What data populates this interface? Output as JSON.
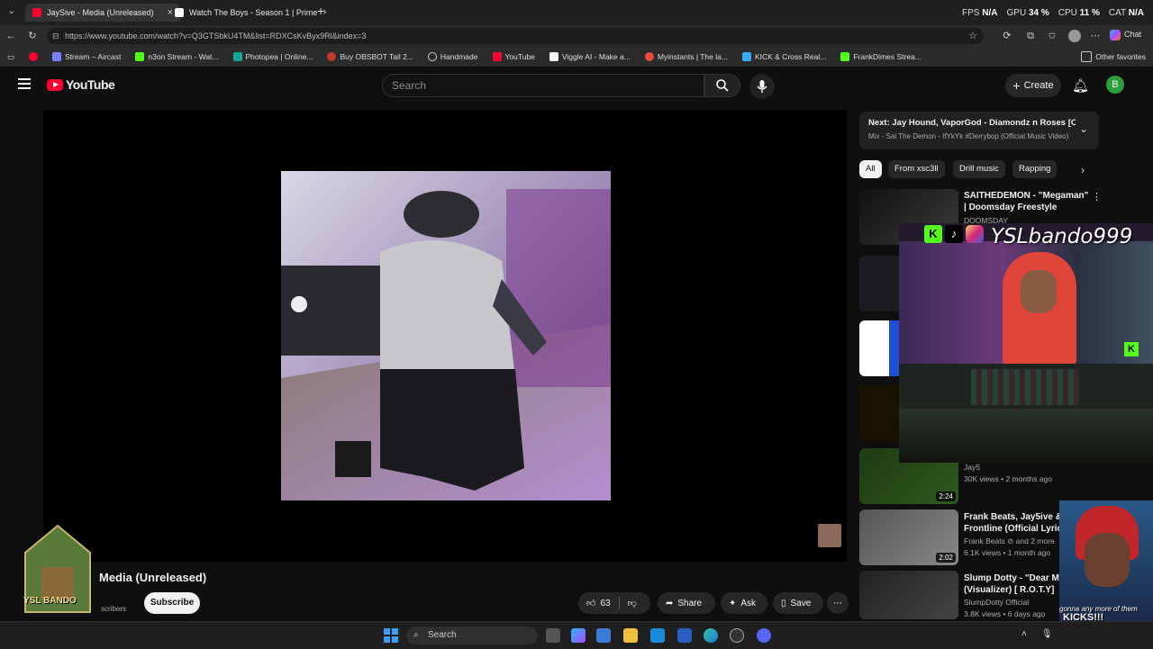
{
  "browser": {
    "tabs": [
      {
        "title": "JaySive - Media (Unreleased)",
        "active": true,
        "favicon_color": "#ff0033"
      },
      {
        "title": "Watch The Boys - Season 1 | Prime",
        "active": false,
        "favicon_color": "#ffffff"
      }
    ],
    "new_tab_symbol": "+",
    "close_symbol": "×",
    "stats": {
      "fps_label": "FPS",
      "fps_value": "N/A",
      "gpu_label": "GPU",
      "gpu_value": "34 %",
      "cpu_label": "CPU",
      "cpu_value": "11 %",
      "cat_label": "CAT",
      "cat_value": "N/A"
    },
    "url": "https://www.youtube.com/watch?v=Q3GTSbkU4TM&list=RDXCsKvByx9Rl&index=3",
    "chat_label": "Chat",
    "bookmarks": [
      {
        "label": "Stream – Aircast",
        "icon_color": "#7f7fff"
      },
      {
        "label": "n3on Stream - Wat...",
        "icon_color": "#53fc18"
      },
      {
        "label": "Photopea | Online...",
        "icon_color": "#18a497"
      },
      {
        "label": "Buy OBSBOT Tail 2...",
        "icon_color": "#c0392b"
      },
      {
        "label": "Handmade",
        "icon_color": "#cccccc"
      },
      {
        "label": "YouTube",
        "icon_color": "#ff0033"
      },
      {
        "label": "Viggle AI - Make a...",
        "icon_color": "#ffffff"
      },
      {
        "label": "Myinstants | The la...",
        "icon_color": "#e74c3c"
      },
      {
        "label": "KICK & Cross Real...",
        "icon_color": "#3fa9f5"
      },
      {
        "label": "FrankDimes Strea...",
        "icon_color": "#53fc18"
      }
    ],
    "other_favorites": "Other favorites"
  },
  "youtube": {
    "logo_text": "YouTube",
    "search_placeholder": "Search",
    "create_label": "Create",
    "avatar_letter": "B",
    "next": {
      "title": "Next: Jay Hound, VaporGod - Diamondz n Roses [O...",
      "subtitle": "Mix - Sai The Demon - IfYkYk #Derrybop (Official Music Video)"
    },
    "chips": [
      "All",
      "From xsc3ll",
      "Drill music",
      "Rapping"
    ],
    "recommendations": [
      {
        "title": "SAITHEDEMON - \"Megaman\" | Doomsday Freestyle",
        "meta1": "DOOMSDAY",
        "meta2": "",
        "duration": ""
      },
      {
        "title": "",
        "meta1": "Jay5",
        "meta2": "30K views • 2 months ago",
        "duration": "2:24"
      },
      {
        "title": "Frank Beats, Jay5ive & Ya... Frontline (Official Lyric Vi...",
        "meta1": "Frank Beats ⊘ and 2 more",
        "meta2": "6.1K views • 1 month ago",
        "duration": "2:02"
      },
      {
        "title": "Slump Dotty - \"Dear Mam... (Visualizer) [ R.O.T.Y]",
        "meta1": "SlumpDotty Official",
        "meta2": "3.8K views • 6 days ago",
        "duration": ""
      }
    ],
    "video": {
      "title_fragment": "Media (Unreleased)",
      "subscribers_fragment": "scribers",
      "subscribe_label": "Subscribe",
      "likes": "63",
      "share_label": "Share",
      "ask_label": "Ask",
      "save_label": "Save"
    }
  },
  "overlay": {
    "handle": "YSLbando999",
    "logo_text": "YSL BANDO",
    "caption_line1": "gonna any more of them",
    "caption_line2": "KICKS!!!"
  },
  "taskbar": {
    "search_label": "Search"
  }
}
